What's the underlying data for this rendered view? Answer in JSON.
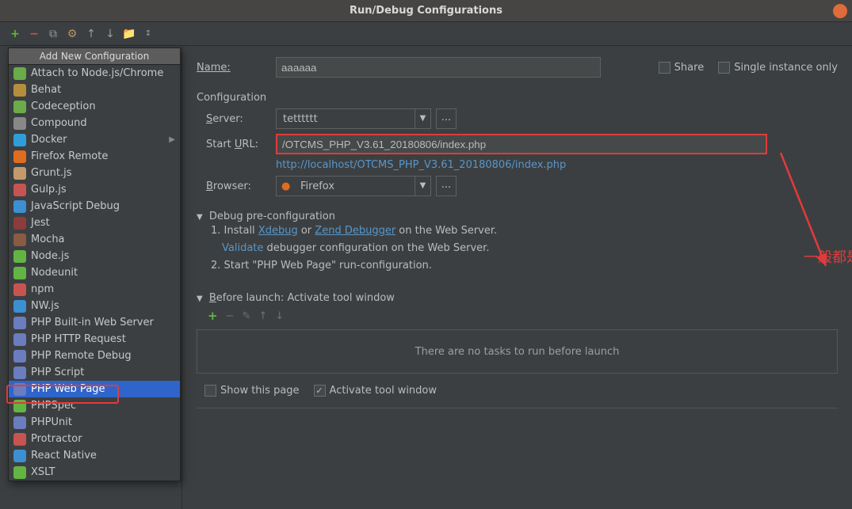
{
  "titlebar": {
    "title": "Run/Debug Configurations"
  },
  "popup": {
    "header": "Add New Configuration",
    "items": [
      {
        "label": "Attach to Node.js/Chrome",
        "color": "#6aab4a"
      },
      {
        "label": "Behat",
        "color": "#b58e3b"
      },
      {
        "label": "Codeception",
        "color": "#6aab4a"
      },
      {
        "label": "Compound",
        "color": "#888888"
      },
      {
        "label": "Docker",
        "color": "#2d9fd8",
        "sub": true
      },
      {
        "label": "Firefox Remote",
        "color": "#e06c1f"
      },
      {
        "label": "Grunt.js",
        "color": "#c49a6c"
      },
      {
        "label": "Gulp.js",
        "color": "#c75450"
      },
      {
        "label": "JavaScript Debug",
        "color": "#3c8fd1"
      },
      {
        "label": "Jest",
        "color": "#8c3c3c"
      },
      {
        "label": "Mocha",
        "color": "#8a5a44"
      },
      {
        "label": "Node.js",
        "color": "#62b543"
      },
      {
        "label": "Nodeunit",
        "color": "#62b543"
      },
      {
        "label": "npm",
        "color": "#c75450"
      },
      {
        "label": "NW.js",
        "color": "#3c8fd1"
      },
      {
        "label": "PHP Built-in Web Server",
        "color": "#6a7dbf"
      },
      {
        "label": "PHP HTTP Request",
        "color": "#6a7dbf"
      },
      {
        "label": "PHP Remote Debug",
        "color": "#6a7dbf"
      },
      {
        "label": "PHP Script",
        "color": "#6a7dbf"
      },
      {
        "label": "PHP Web Page",
        "color": "#6a7dbf",
        "selected": true
      },
      {
        "label": "PHPSpec",
        "color": "#62b543"
      },
      {
        "label": "PHPUnit",
        "color": "#6a7dbf"
      },
      {
        "label": "Protractor",
        "color": "#c75450"
      },
      {
        "label": "React Native",
        "color": "#3c8fd1"
      },
      {
        "label": "XSLT",
        "color": "#62b543"
      }
    ]
  },
  "main": {
    "nameLabel": "Name:",
    "nameValue": "aaaaaa",
    "shareLabel": "Share",
    "singleLabel": "Single instance only",
    "configTitle": "Configuration",
    "serverLabel": "Server:",
    "serverValue": "tetttttt",
    "startUrlLabel": "Start URL:",
    "startUrlValue": "/OTCMS_PHP_V3.61_20180806/index.php",
    "fullUrl": "http://localhost/OTCMS_PHP_V3.61_20180806/index.php",
    "browserLabel": "Browser:",
    "browserValue": "Firefox",
    "debugTitle": "Debug pre-configuration",
    "step1a": "1. Install ",
    "xdebug": "Xdebug",
    "or": "  or  ",
    "zend": "Zend Debugger",
    "step1b": " on the Web Server.",
    "validate": "Validate",
    "step1c": " debugger configuration on the Web Server.",
    "step2": "2. Start \"PHP Web Page\" run-configuration.",
    "beforeTitle": "Before launch: Activate tool window",
    "noTasks": "There are no tasks to run before launch",
    "showPage": "Show this page",
    "activateTool": "Activate tool window",
    "annotation": "一般都是首页"
  }
}
